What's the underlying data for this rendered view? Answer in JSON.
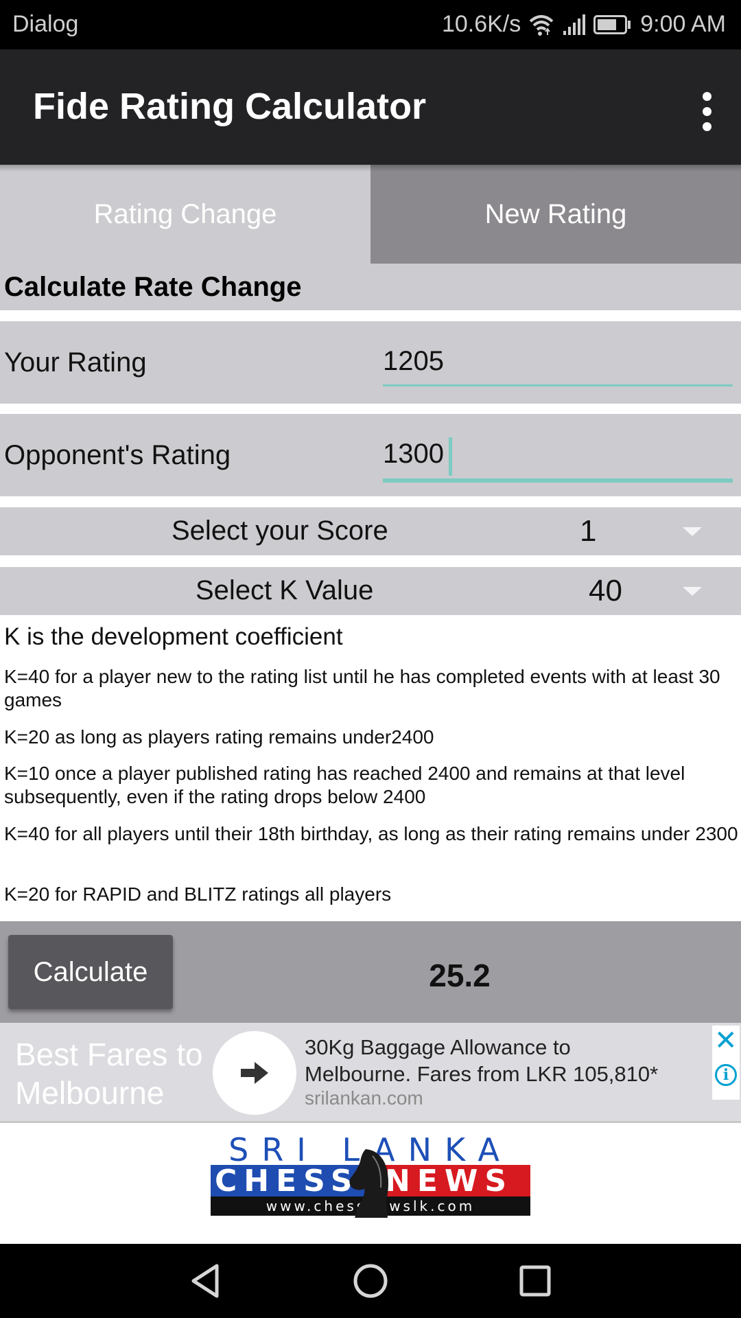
{
  "status_bar": {
    "carrier": "Dialog",
    "network_speed": "10.6K/s",
    "time": "9:00 AM",
    "icons": [
      "wifi-icon",
      "signal-icon",
      "battery-icon"
    ]
  },
  "app_bar": {
    "title": "Fide Rating Calculator",
    "menu_icon": "overflow-menu-icon"
  },
  "tabs": [
    {
      "label": "Rating Change",
      "selected": true
    },
    {
      "label": "New Rating",
      "selected": false
    }
  ],
  "form": {
    "section_title": "Calculate Rate Change",
    "your_rating": {
      "label": "Your Rating",
      "value": "1205"
    },
    "opponent_rating": {
      "label": "Opponent's Rating",
      "value": "1300"
    },
    "score": {
      "label": "Select your Score",
      "value": "1"
    },
    "k_value": {
      "label": "Select K Value",
      "value": "40"
    }
  },
  "info": {
    "heading": "K is the development coefficient",
    "paragraphs": [
      "K=40 for a player new to the rating list until he has completed events with at least 30 games",
      "K=20 as long as players rating remains under2400",
      "K=10 once a player published rating has reached 2400 and remains at that level subsequently, even if the rating drops below 2400",
      "K=40 for all players until their 18th birthday, as long as their rating remains under 2300",
      "K=20 for RAPID and BLITZ ratings all players"
    ]
  },
  "calculate": {
    "button_label": "Calculate",
    "result": "25.2"
  },
  "ad": {
    "left_text_line1": "Best Fares to",
    "left_text_line2": "Melbourne",
    "headline_line1": "30Kg Baggage Allowance to",
    "headline_line2": "Melbourne. Fares from LKR 105,810*",
    "domain": "srilankan.com",
    "close_symbol": "✕",
    "info_symbol": "i"
  },
  "logo": {
    "top": "SRI LANKA",
    "left_band": "CHESS",
    "right_band": "NEWS",
    "url": "www.chessnewslk.com"
  },
  "colors": {
    "accent": "#7ecbc2",
    "app_bar": "#232225",
    "tab_selected": "#cccbcf",
    "tab_unselected": "#8b898d",
    "ad_accent": "#00a0d1"
  }
}
